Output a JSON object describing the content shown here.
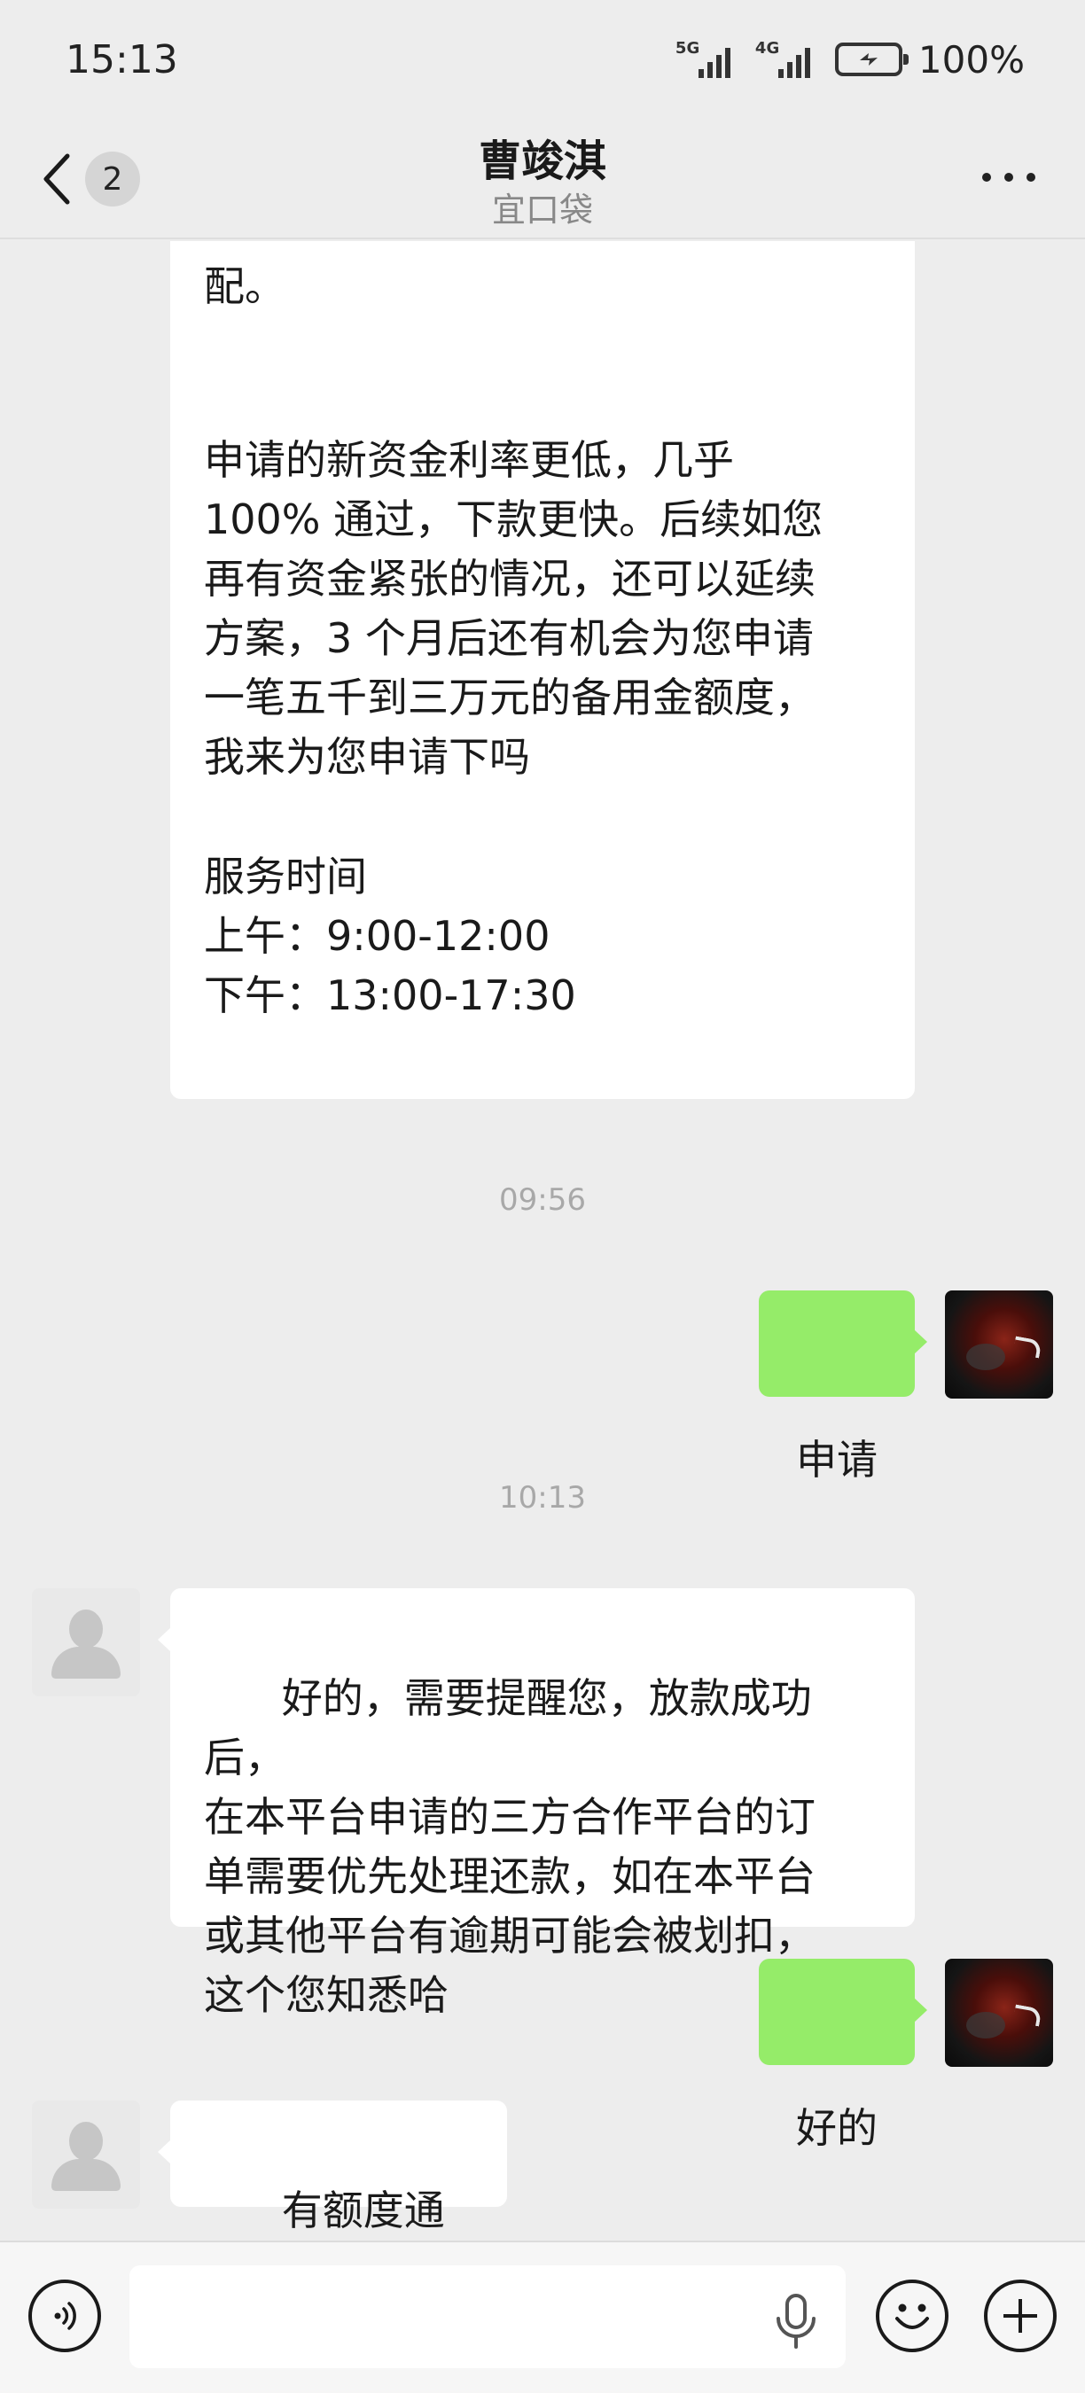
{
  "status_bar": {
    "time": "15:13",
    "network_1": "5G",
    "network_2": "4G",
    "battery": "100%"
  },
  "header": {
    "back_badge": "2",
    "title": "曹竣淇",
    "subtitle": "宜口袋"
  },
  "messages": {
    "long_message": {
      "top_partial": "配。",
      "paragraph_2": "申请的新资金利率更低，几乎\n100% 通过，下款更快。后续如您\n再有资金紧张的情况，还可以延续\n方案，3 个月后还有机会为您申请\n一笔五千到三万元的备用金额度，\n我来为您申请下吗",
      "service_heading": "服务时间",
      "service_am": "上午：9:00-12:00",
      "service_pm": "下午：13:00-17:30"
    },
    "time_1": "09:56",
    "reply_1": "申请",
    "time_2": "10:13",
    "agent_2": "好的，需要提醒您，放款成功后，\n在本平台申请的三方合作平台的订\n单需要优先处理还款，如在本平台\n或其他平台有逾期可能会被划扣，\n这个您知悉哈",
    "reply_2": "好的",
    "agent_3": "有额度通知你"
  },
  "input_bar": {
    "text_value": ""
  },
  "icons": {
    "back": "chevron-left-icon",
    "more": "more-dots-icon",
    "voice": "voice-icon",
    "mic": "mic-icon",
    "emoji": "emoji-icon",
    "plus": "plus-icon"
  },
  "colors": {
    "background": "#ededed",
    "incoming_bubble": "#ffffff",
    "outgoing_bubble": "#95ec69",
    "timestamp": "#a8a8a8"
  }
}
